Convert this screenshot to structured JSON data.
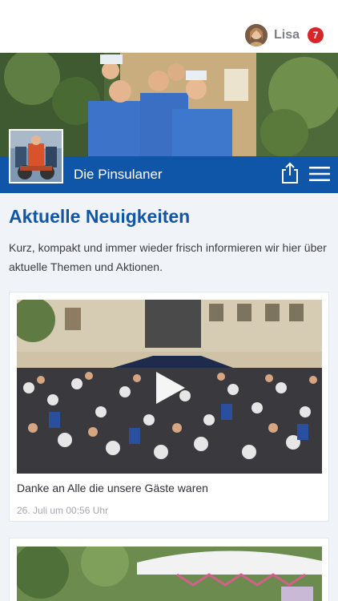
{
  "user": {
    "name": "Lisa",
    "notifications": "7"
  },
  "group": {
    "name": "Die Pinsulaner"
  },
  "news": {
    "title": "Aktuelle Neuigkeiten",
    "description": "Kurz, kompakt und immer wieder frisch informieren wir hier über aktuelle Themen und Aktionen."
  },
  "posts": [
    {
      "title": "Danke an Alle die unsere Gäste waren",
      "date": "26. Juli um 00:56 Uhr"
    }
  ],
  "colors": {
    "primary": "#0f55a8",
    "badge": "#d9252a",
    "background": "#f0f3f8"
  },
  "icons": {
    "share": "share-icon",
    "menu": "hamburger-menu-icon",
    "play": "play-icon"
  }
}
